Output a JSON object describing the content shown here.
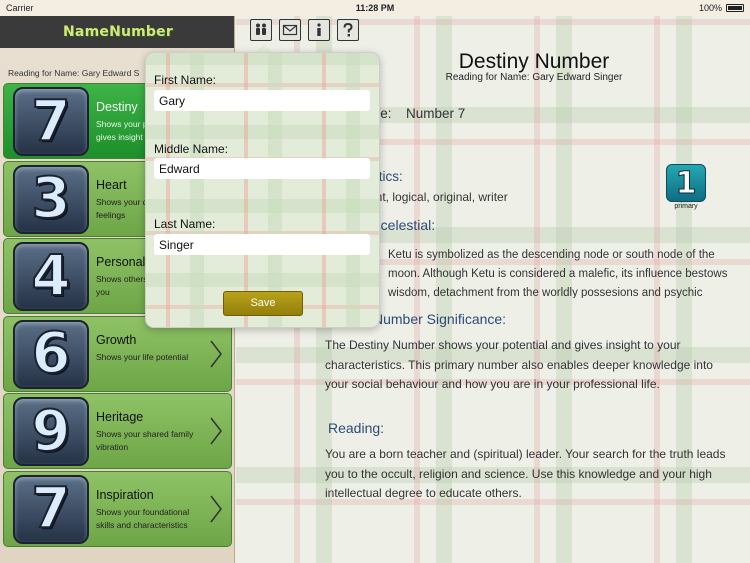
{
  "status_bar": {
    "carrier": "Carrier",
    "time": "11:28 PM",
    "battery": "100%"
  },
  "sidebar": {
    "logo": "NameNumber",
    "reading_for": "Reading for Name: Gary Edward S",
    "items": [
      {
        "number": "7",
        "title": "Destiny",
        "desc": "Shows your p\ngives insight",
        "active": true
      },
      {
        "number": "3",
        "title": "Heart",
        "desc": "Shows your de\nfeelings",
        "active": false
      },
      {
        "number": "4",
        "title": "Personalit",
        "desc": "Shows others\nyou",
        "active": false
      },
      {
        "number": "6",
        "title": "Growth",
        "desc": "Shows your life potential",
        "active": false
      },
      {
        "number": "9",
        "title": "Heritage",
        "desc": "Shows your shared family vibration",
        "active": false
      },
      {
        "number": "7",
        "title": "Inspiration",
        "desc": "Shows your foundational skills and characteristics",
        "active": false
      }
    ]
  },
  "toolbar": {
    "icons": [
      "people-icon",
      "mail-icon",
      "info-icon",
      "help-icon"
    ]
  },
  "main": {
    "title": "Destiny Number",
    "subtitle": "Reading for Name: Gary Edward Singer",
    "name_line_prefix": "me:",
    "name_line_value": "Number 7",
    "characteristics_heading": "istics:",
    "characteristics_text": "ent, logical, original, writer",
    "celestial_heading": "g celestial:",
    "celestial_text": "Ketu is symbolized as the descending node or south node of the moon.  Although Ketu is considered a malefic, its influence bestows wisdom, detachment from the worldly possesions and psychic",
    "significance_heading": "Number Significance:",
    "significance_text": "The Destiny Number shows your potential and gives insight to your characteristics. This primary number also enables deeper knowledge into your social behaviour and how you are in your professional life.",
    "reading_heading": "Reading:",
    "reading_text": "You are a born teacher and (spiritual) leader. Your search for the truth leads you to the occult, religion and science. Use this knowledge and your high intellectual degree to educate others.",
    "badge_number": "1",
    "badge_caption": "primary"
  },
  "popover": {
    "first_name_label": "First Name:",
    "first_name_value": "Gary",
    "middle_name_label": "Middle Name:",
    "middle_name_value": "Edward",
    "last_name_label": "Last Name:",
    "last_name_value": "Singer",
    "save_label": "Save"
  }
}
